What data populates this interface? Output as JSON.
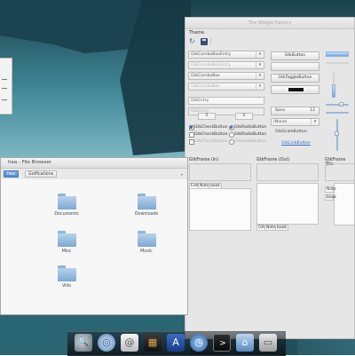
{
  "widget_factory": {
    "title": "The Widget Factory",
    "menu": {
      "theme": "Theme"
    },
    "toolbar": {
      "refresh_icon": "refresh-icon",
      "save_icon": "save-icon"
    },
    "combos": [
      {
        "label": "GtkComboBoxEntry",
        "state": "normal"
      },
      {
        "label": "GtkComboBoxEntry",
        "state": "disabled"
      },
      {
        "label": "GtkComboBox",
        "state": "normal"
      },
      {
        "label": "GtkComboBox",
        "state": "disabled"
      }
    ],
    "entries": [
      {
        "value": "GtkEntry",
        "state": "normal"
      },
      {
        "value": "GtkEntry",
        "state": "disabled"
      }
    ],
    "spinbuttons": [
      {
        "value": "0"
      },
      {
        "value": "0"
      }
    ],
    "checks": [
      {
        "label": "GtkCheckButton",
        "checked": true,
        "state": "normal"
      },
      {
        "label": "GtkCheckButton",
        "checked": false,
        "state": "normal"
      },
      {
        "label": "GtkCheckButton",
        "checked": false,
        "state": "disabled"
      }
    ],
    "radios": [
      {
        "label": "GtkRadioButton",
        "checked": true,
        "state": "normal"
      },
      {
        "label": "GtkRadioButton",
        "checked": false,
        "state": "normal"
      },
      {
        "label": "GtkRadioButton",
        "checked": false,
        "state": "disabled"
      }
    ],
    "buttons": {
      "button": "GtkButton",
      "toggle": "GtkToggleButton",
      "font": "Sans",
      "font_size": "12",
      "none_combo": "(None)",
      "scale": "GtkScaleButton",
      "link": "GtkLinkButton"
    },
    "frames": [
      {
        "label": "GtkFrame (In)"
      },
      {
        "label": "GtkFrame (Out)"
      },
      {
        "label": "GtkFrame (Etc"
      }
    ],
    "notebooks": [
      {
        "tabs": [
          "Edit",
          "Note",
          "book"
        ]
      },
      {
        "tabs": [
          "Gtk",
          "Note",
          "book"
        ]
      },
      {
        "tabs": [
          "Note",
          "book"
        ]
      }
    ],
    "accent": "#3c74b8"
  },
  "file_browser": {
    "title": "hea - File Browser",
    "path": [
      "hea",
      "Goifications"
    ],
    "folders": [
      {
        "name": "Documents"
      },
      {
        "name": "Downloads"
      },
      {
        "name": "Misc"
      },
      {
        "name": "Music"
      },
      {
        "name": "Vids"
      }
    ],
    "folder_color": "#8fb7dc"
  },
  "dock": {
    "items": [
      {
        "name": "magnifier-icon",
        "glyph": "🔍"
      },
      {
        "name": "browser-icon",
        "glyph": "◎"
      },
      {
        "name": "mail-icon",
        "glyph": "@"
      },
      {
        "name": "movie-icon",
        "glyph": "▦"
      },
      {
        "name": "app-store-icon",
        "glyph": "A"
      },
      {
        "name": "clock-icon",
        "glyph": "◷"
      },
      {
        "name": "terminal-icon",
        "glyph": ">"
      },
      {
        "name": "home-icon",
        "glyph": "⌂"
      },
      {
        "name": "window-icon",
        "glyph": "▭"
      }
    ]
  }
}
